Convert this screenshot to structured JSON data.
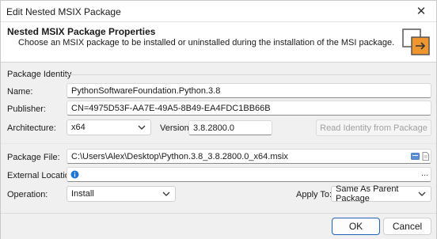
{
  "window": {
    "title": "Edit Nested MSIX Package",
    "close_glyph": "✕"
  },
  "header": {
    "title": "Nested MSIX Package Properties",
    "description": "Choose an MSIX package to be installed or uninstalled during the installation of the MSI package.",
    "icon": "package-copy-icon",
    "icon_accent": "#f0962f"
  },
  "identity": {
    "group_label": "Package Identity",
    "name_label": "Name:",
    "name_value": "PythonSoftwareFoundation.Python.3.8",
    "publisher_label": "Publisher:",
    "publisher_value": "CN=4975D53F-AA7E-49A5-8B49-EA4FDC1BB66B",
    "architecture_label": "Architecture:",
    "architecture_value": "x64",
    "version_label": "Version:",
    "version_value": "3.8.2800.0",
    "read_identity_label": "Read Identity from Package"
  },
  "package": {
    "file_label": "Package File:",
    "file_value": "C:\\Users\\Alex\\Desktop\\Python.3.8_3.8.2800.0_x64.msix",
    "external_label": "External Location:",
    "external_value": "",
    "external_more": "...",
    "operation_label": "Operation:",
    "operation_value": "Install",
    "apply_to_label": "Apply To:",
    "apply_to_value": "Same As Parent Package"
  },
  "footer": {
    "ok_label": "OK",
    "cancel_label": "Cancel"
  },
  "colors": {
    "accent_blue": "#1e63b5",
    "info_blue": "#1a73d9",
    "orange": "#f0962f"
  }
}
